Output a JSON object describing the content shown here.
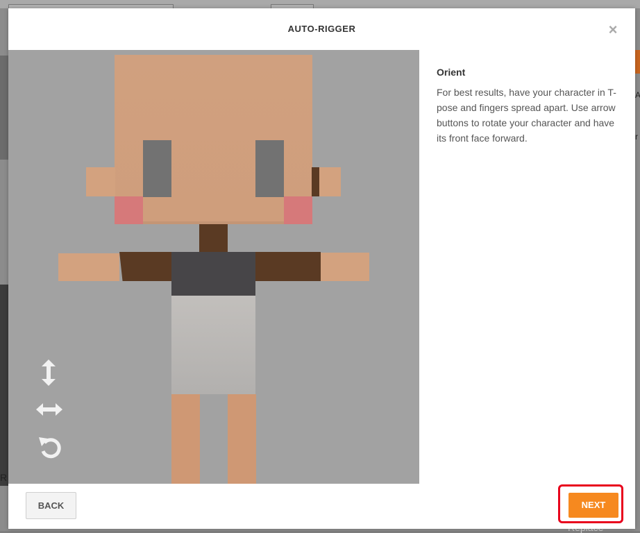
{
  "modal": {
    "title": "AUTO-RIGGER",
    "close_symbol": "×"
  },
  "panel": {
    "title": "Orient",
    "description": "For best results, have your character in T-pose and fingers spread apart. Use arrow buttons to rotate your character and have its front face forward."
  },
  "footer": {
    "back_label": "BACK",
    "next_label": "NEXT"
  },
  "background": {
    "left_text": "R",
    "right_text_1": "A",
    "right_text_2": "r",
    "replace_label": "Replace"
  },
  "icons": {
    "vertical": "vertical-arrows-icon",
    "horizontal": "horizontal-arrows-icon",
    "rotate": "rotate-icon",
    "close": "close-icon"
  },
  "colors": {
    "accent": "#f6891f",
    "highlight": "#e8001c",
    "viewport": "#a2a2a2",
    "skin": "#d3a27f",
    "hair_dark": "#5a3a23",
    "shirt": "#474548"
  }
}
